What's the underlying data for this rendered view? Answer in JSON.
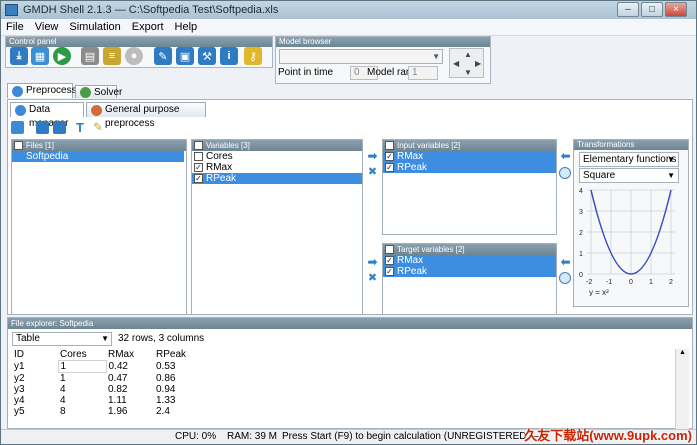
{
  "window": {
    "title": "GMDH Shell 2.1.3 — C:\\Softpedia Test\\Softpedia.xls",
    "min": "–",
    "max": "□",
    "close": "×"
  },
  "menu": [
    "File",
    "View",
    "Simulation",
    "Export",
    "Help"
  ],
  "control_panel": {
    "title": "Control panel"
  },
  "model_browser": {
    "title": "Model browser",
    "point_in_time_label": "Point in time",
    "point_in_time_value": "0",
    "model_rank_label": "Model rank",
    "model_rank_value": "1"
  },
  "main_tabs": [
    {
      "label": "Preprocess"
    },
    {
      "label": "Solver"
    }
  ],
  "sub_tabs": [
    {
      "label": "Data manager"
    },
    {
      "label": "General purpose preprocess"
    }
  ],
  "files": {
    "header": "Files [1]",
    "items": [
      "Softpedia"
    ]
  },
  "variables": {
    "header": "Variables [3]",
    "items": [
      {
        "label": "Cores",
        "checked": false,
        "selected": false
      },
      {
        "label": "RMax",
        "checked": true,
        "selected": false
      },
      {
        "label": "RPeak",
        "checked": true,
        "selected": true
      }
    ]
  },
  "input_variables": {
    "header": "Input variables [2]",
    "items": [
      "RMax",
      "RPeak"
    ]
  },
  "target_variables": {
    "header": "Target variables [2]",
    "items": [
      "RMax",
      "RPeak"
    ]
  },
  "transformations": {
    "title": "Transformations",
    "function_group": "Elementary functions",
    "function": "Square",
    "formula": "y = x²",
    "x_ticks": [
      "-2",
      "-1",
      "0",
      "1",
      "2"
    ],
    "y_ticks": [
      "0",
      "1",
      "2",
      "3",
      "4"
    ]
  },
  "file_explorer": {
    "title": "File explorer: Softpedia",
    "view": "Table",
    "info": "32 rows, 3 columns",
    "columns": [
      "ID",
      "Cores",
      "RMax",
      "RPeak"
    ],
    "rows": [
      [
        "y1",
        "1",
        "0.42",
        "0.53"
      ],
      [
        "y2",
        "1",
        "0.47",
        "0.86"
      ],
      [
        "y3",
        "4",
        "0.82",
        "0.94"
      ],
      [
        "y4",
        "4",
        "1.11",
        "1.33"
      ],
      [
        "y5",
        "8",
        "1.96",
        "2.4"
      ]
    ]
  },
  "status": {
    "cpu": "CPU: 0%",
    "ram": "RAM: 39 M",
    "message": "Press Start (F9) to begin calculation (UNREGISTERED — "
  },
  "watermark": "久友下载站(www.9upk.com)"
}
